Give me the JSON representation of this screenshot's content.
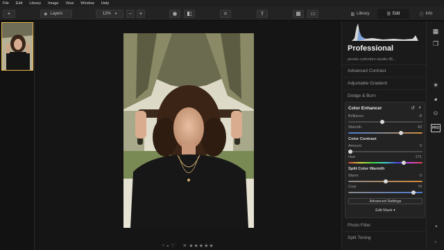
{
  "menu": [
    "File",
    "Edit",
    "Library",
    "Image",
    "View",
    "Window",
    "Help"
  ],
  "toolbar": {
    "layers_label": "Layers",
    "zoom_value": "12%",
    "tabs": [
      {
        "label": "Library",
        "icon": "library-icon"
      },
      {
        "label": "Edit",
        "icon": "sliders-icon",
        "active": true
      },
      {
        "label": "Info",
        "icon": "info-icon"
      }
    ]
  },
  "panel": {
    "title": "Professional",
    "preset_name": "pexels-cottonbro-studio-45...",
    "tools_above": [
      "Advanced Contrast",
      "Adjustable Gradient",
      "Dodge & Burn"
    ],
    "tools_below": [
      "Photo Filter",
      "Split Toning"
    ],
    "enhancer": {
      "title": "Color Enhancer",
      "sliders_main": [
        {
          "label": "Brilliance",
          "value": "-8",
          "fraction": 0.46
        },
        {
          "label": "Warmth",
          "value": "43",
          "fraction": 0.72
        }
      ],
      "contrast_head": "Color Contrast",
      "sliders_contrast": [
        {
          "label": "Amount",
          "value": "0",
          "fraction": 0.0
        },
        {
          "label": "Hue",
          "value": "271",
          "fraction": 0.76
        }
      ],
      "split_head": "Split Color Warmth",
      "sliders_split": [
        {
          "label": "Warm",
          "value": "0",
          "fraction": 0.5
        },
        {
          "label": "Cool",
          "value": "79",
          "fraction": 0.9
        }
      ],
      "advanced_label": "Advanced Settings",
      "mask_label": "Edit Mask ▾"
    }
  },
  "bottom": {
    "rating_stars": 5
  },
  "colors": {
    "accent_thumb": "#e8b54a",
    "panel_bg": "#1a1a1a"
  }
}
